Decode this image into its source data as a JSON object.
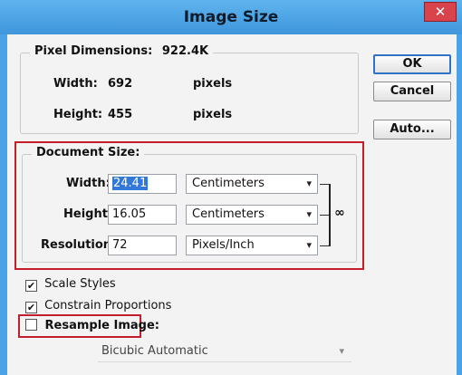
{
  "window": {
    "title": "Image Size",
    "close_glyph": "✕"
  },
  "pixel_dimensions": {
    "legend": "Pixel Dimensions:",
    "size": "922.4K",
    "width_label": "Width:",
    "width_value": "692",
    "width_unit": "pixels",
    "height_label": "Height:",
    "height_value": "455",
    "height_unit": "pixels"
  },
  "document_size": {
    "legend": "Document Size:",
    "width_label": "Width:",
    "width_value": "24.41",
    "width_unit": "Centimeters",
    "height_label": "Height:",
    "height_value": "16.05",
    "height_unit": "Centimeters",
    "resolution_label": "Resolution:",
    "resolution_value": "72",
    "resolution_unit": "Pixels/Inch"
  },
  "buttons": {
    "ok": "OK",
    "cancel": "Cancel",
    "auto": "Auto..."
  },
  "options": {
    "scale_styles": {
      "label": "Scale Styles",
      "checked": true
    },
    "constrain_proportions": {
      "label": "Constrain Proportions",
      "checked": true
    },
    "resample_image": {
      "label": "Resample Image:",
      "checked": false
    },
    "resample_method": "Bicubic Automatic"
  },
  "icons": {
    "link": "chain-link-icon",
    "dropdown": "chevron-down-icon",
    "check": "checkmark-icon"
  },
  "colors": {
    "title_bar": "#4aa3e6",
    "highlight": "#c41e2c",
    "selection": "#3378d6"
  }
}
